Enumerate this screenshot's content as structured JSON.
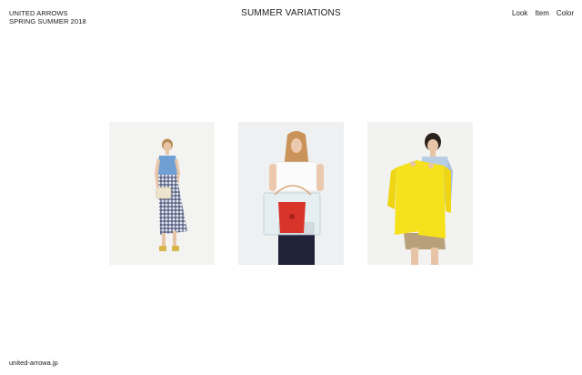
{
  "brand": {
    "line1": "UNITED ARROWS",
    "line2": "SPRING SUMMER 2018"
  },
  "title": "SUMMER VARIATIONS",
  "nav": {
    "items": [
      {
        "label": "Look"
      },
      {
        "label": "Item"
      },
      {
        "label": "Color"
      }
    ]
  },
  "gallery": {
    "looks": [
      {
        "name": "look-1",
        "outfit": "blue blouse, gingham skirt, cream bag"
      },
      {
        "name": "look-2",
        "outfit": "white tee, navy pants, clear tote with red bag"
      },
      {
        "name": "look-3",
        "outfit": "yellow shirt held up, striped shirt, khaki shorts"
      }
    ]
  },
  "footer": {
    "link": "united-arrowa.jp"
  },
  "colors": {
    "text": "#1a1a1a",
    "background": "#ffffff",
    "photo_bg": "#f3f3f1",
    "accent_yellow": "#f5e21c",
    "accent_red": "#d8342a",
    "accent_blue": "#6f9fd3"
  }
}
